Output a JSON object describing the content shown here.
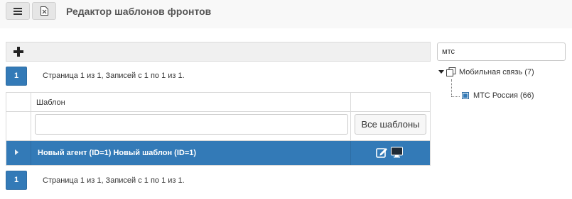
{
  "header": {
    "title": "Редактор шаблонов фронтов",
    "menu_icon": "menu-icon",
    "excel_icon": "excel-export-icon"
  },
  "toolbar": {
    "add_icon": "plus-icon",
    "add_label": "+"
  },
  "pager_top": {
    "page": "1",
    "info": "Страница 1 из 1, Записей с 1 по 1 из 1."
  },
  "grid": {
    "columns": [
      "",
      "Шаблон",
      ""
    ],
    "filter_value": "",
    "all_templates_label": "Все шаблоны",
    "rows": [
      {
        "text": "Новый агент (ID=1) Новый шаблон (ID=1)",
        "selected": true,
        "icons": [
          "edit-icon",
          "monitor-icon"
        ]
      }
    ]
  },
  "pager_bottom": {
    "page": "1",
    "info": "Страница 1 из 1, Записей с 1 по 1 из 1."
  },
  "sidebar": {
    "search_value": "мтс",
    "tree": [
      {
        "label": "Мобильная связь (7)",
        "expanded": true,
        "icon": "copy-group-icon",
        "children": [
          {
            "label": "МТС Россия (66)",
            "icon": "leaf-square-icon"
          }
        ]
      }
    ]
  },
  "colors": {
    "accent": "#337ab7",
    "selected_row": "#337ab7",
    "topbar": "#f8f8f8"
  }
}
